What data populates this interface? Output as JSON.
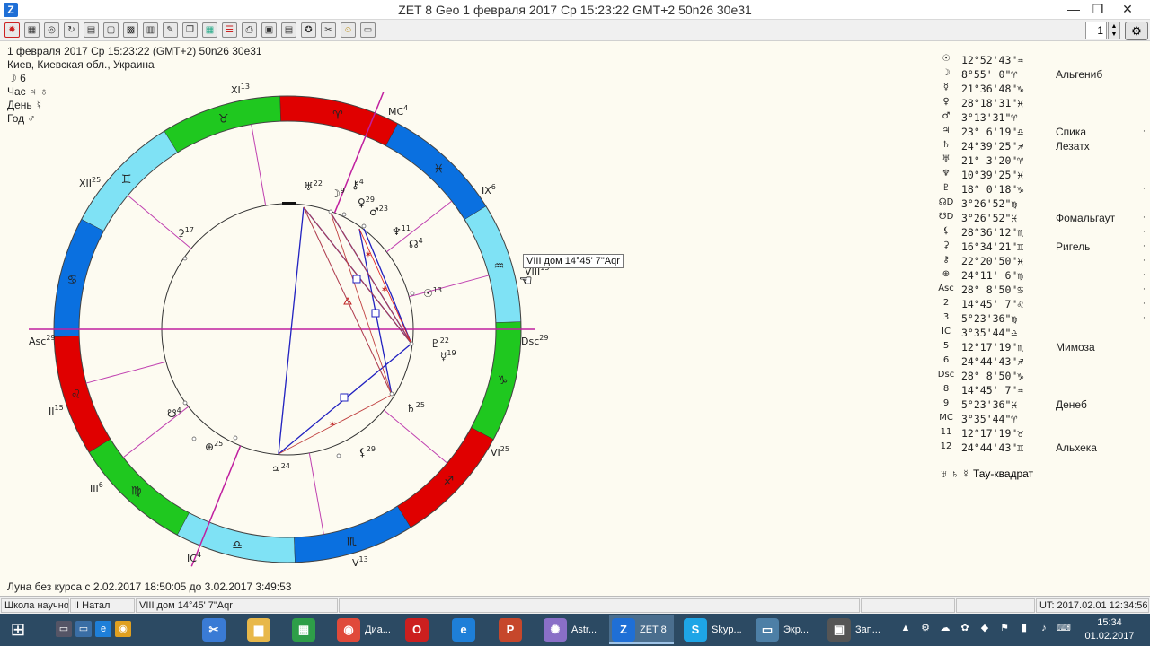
{
  "window": {
    "title": "ZET 8 Geo     1 февраля 2017  Ср   15:23:22 GMT+2 50n26  30e31",
    "minimize": "—",
    "restore": "❐",
    "close": "✕",
    "app_icon": "Z"
  },
  "toolbar": {
    "zoom_value": "1"
  },
  "header_info": {
    "line1": "1 февраля 2017  Ср   15:23:22 (GMT+2) 50n26  30e31",
    "line2": "Киев, Киевская обл., Украина",
    "moon_line": "☽  6",
    "hour_line": "Час ♃ ♁",
    "day_line": "День ☿",
    "year_line": "Год ♂"
  },
  "chart": {
    "house_labels": [
      {
        "text": "XI",
        "sup": "13"
      },
      {
        "text": "MC",
        "sup": "4"
      },
      {
        "text": "IX",
        "sup": "6"
      },
      {
        "text": "VIII",
        "sup": "15"
      },
      {
        "text": "Dsc",
        "sup": "29"
      },
      {
        "text": "VI",
        "sup": "25"
      },
      {
        "text": "V",
        "sup": "13"
      },
      {
        "text": "IC",
        "sup": "4"
      },
      {
        "text": "III",
        "sup": "6"
      },
      {
        "text": "II",
        "sup": "15"
      },
      {
        "text": "Asc",
        "sup": "29"
      },
      {
        "text": "XII",
        "sup": "25"
      }
    ],
    "planet_labels": [
      {
        "glyph": "♅",
        "deg": "22"
      },
      {
        "glyph": "☽",
        "deg": "9"
      },
      {
        "glyph": "⚷",
        "deg": "4"
      },
      {
        "glyph": "♀",
        "deg": "29"
      },
      {
        "glyph": "♂",
        "deg": "23"
      },
      {
        "glyph": "♆",
        "deg": "11"
      },
      {
        "glyph": "☊",
        "deg": "4"
      },
      {
        "glyph": "☉",
        "deg": "13"
      },
      {
        "glyph": "♇",
        "deg": "22"
      },
      {
        "glyph": "☿",
        "deg": "19"
      },
      {
        "glyph": "♄",
        "deg": "25"
      },
      {
        "glyph": "⚸",
        "deg": "29"
      },
      {
        "glyph": "♃",
        "deg": "24"
      },
      {
        "glyph": "⊕",
        "deg": "25"
      },
      {
        "glyph": "☋",
        "deg": "4"
      },
      {
        "glyph": "⚳",
        "deg": "17"
      }
    ],
    "zodiac_glyphs": [
      "♈",
      "♓",
      "♒",
      "♑",
      "♐",
      "♏",
      "♎",
      "♍",
      "♌",
      "♋",
      "♊",
      "♉"
    ]
  },
  "tooltip": "VIII дом 14°45' 7\"Aqr",
  "positions": [
    {
      "sym": "☉",
      "pos": "12°52'43\"♒",
      "star": ""
    },
    {
      "sym": "☽",
      "pos": " 8°55' 0\"♈",
      "star": "Альгениб"
    },
    {
      "sym": "☿",
      "pos": "21°36'48\"♑",
      "star": ""
    },
    {
      "sym": "♀",
      "pos": "28°18'31\"♓",
      "star": ""
    },
    {
      "sym": "♂",
      "pos": " 3°13'31\"♈",
      "star": ""
    },
    {
      "sym": "♃",
      "pos": "23° 6'19\"♎",
      "star": "Спика"
    },
    {
      "sym": "♄",
      "pos": "24°39'25\"♐",
      "star": "Лезатх"
    },
    {
      "sym": "♅",
      "pos": "21° 3'20\"♈",
      "star": ""
    },
    {
      "sym": "♆",
      "pos": "10°39'25\"♓",
      "star": ""
    },
    {
      "sym": "♇",
      "pos": "18° 0'18\"♑",
      "star": ""
    },
    {
      "sym": "☊D",
      "pos": " 3°26'52\"♍",
      "star": ""
    },
    {
      "sym": "☋D",
      "pos": " 3°26'52\"♓",
      "star": "Фомальгаут"
    },
    {
      "sym": "⚸",
      "pos": "28°36'12\"♏",
      "star": ""
    },
    {
      "sym": "⚳",
      "pos": "16°34'21\"♊",
      "star": "Ригель"
    },
    {
      "sym": "⚷",
      "pos": "22°20'50\"♓",
      "star": ""
    },
    {
      "sym": "⊕",
      "pos": "24°11' 6\"♍",
      "star": ""
    },
    {
      "sym": "Asc",
      "pos": "28° 8'50\"♋",
      "star": ""
    },
    {
      "sym": "2",
      "pos": "14°45' 7\"♌",
      "star": ""
    },
    {
      "sym": "3",
      "pos": " 5°23'36\"♍",
      "star": ""
    },
    {
      "sym": "IC",
      "pos": " 3°35'44\"♎",
      "star": ""
    },
    {
      "sym": "5",
      "pos": "12°17'19\"♏",
      "star": "Мимоза"
    },
    {
      "sym": "6",
      "pos": "24°44'43\"♐",
      "star": ""
    },
    {
      "sym": "Dsc",
      "pos": "28° 8'50\"♑",
      "star": ""
    },
    {
      "sym": "8",
      "pos": "14°45' 7\"♒",
      "star": ""
    },
    {
      "sym": "9",
      "pos": " 5°23'36\"♓",
      "star": "Денеб"
    },
    {
      "sym": "MC",
      "pos": " 3°35'44\"♈",
      "star": ""
    },
    {
      "sym": "11",
      "pos": "12°17'19\"♉",
      "star": ""
    },
    {
      "sym": "12",
      "pos": "24°44'43\"♊",
      "star": "Альхека"
    }
  ],
  "tau_square": "♅ ♄ ☿  Тау-квадрат",
  "moon_void": "Луна без курса с 2.02.2017 18:50:05 до 3.02.2017  3:49:53",
  "statusbar": {
    "cell1": "Школа научной",
    "cell2": "II Натал",
    "cell3": "VIII дом 14°45' 7\"Aqr",
    "ut": "UT: 2017.02.01 12:34:56"
  },
  "taskbar": {
    "apps": [
      {
        "label": "Диа...",
        "icon": "◉",
        "color": "#e04a3a"
      },
      {
        "label": "",
        "icon": "O",
        "color": "#cc1f1f"
      },
      {
        "label": "",
        "icon": "e",
        "color": "#1e7fd8"
      },
      {
        "label": "",
        "icon": "P",
        "color": "#c6472b"
      },
      {
        "label": "Astr...",
        "icon": "✺",
        "color": "#8a6fc7"
      },
      {
        "label": "ZET 8",
        "icon": "Z",
        "color": "#1f6fd6"
      },
      {
        "label": "Skyp...",
        "icon": "S",
        "color": "#1ea5e6"
      },
      {
        "label": "Экр...",
        "icon": "▭",
        "color": "#4d7fa6"
      },
      {
        "label": "Зап...",
        "icon": "▣",
        "color": "#555"
      }
    ],
    "time": "15:34",
    "date": "01.02.2017"
  }
}
